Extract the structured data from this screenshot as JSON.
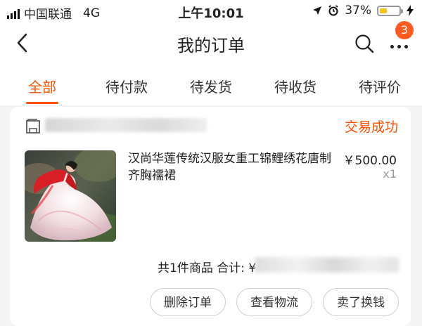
{
  "status_bar": {
    "carrier": "中国联通",
    "network": "4G",
    "time": "上午10:01",
    "battery": "37%",
    "battery_level": 0.37
  },
  "nav": {
    "title": "我的订单",
    "badge_count": "3",
    "icons": [
      "back-chevron-icon",
      "search-icon",
      "more-dots-icon"
    ]
  },
  "tabs": [
    {
      "label": "全部",
      "active": true
    },
    {
      "label": "待付款",
      "active": false
    },
    {
      "label": "待发货",
      "active": false
    },
    {
      "label": "待收货",
      "active": false
    },
    {
      "label": "待评价",
      "active": false
    }
  ],
  "order": {
    "status": "交易成功",
    "product_title": "汉尚华莲传统汉服女重工锦鲤绣花唐制齐胸襦裙",
    "price": "￥500.00",
    "quantity": "x1",
    "summary": "共1件商品 合计: ¥",
    "buttons": [
      "删除订单",
      "查看物流",
      "卖了换钱"
    ]
  },
  "colors": {
    "accent": "#ff5000",
    "badge": "#ff5a1f",
    "battery_fill": "#f4c21c"
  }
}
